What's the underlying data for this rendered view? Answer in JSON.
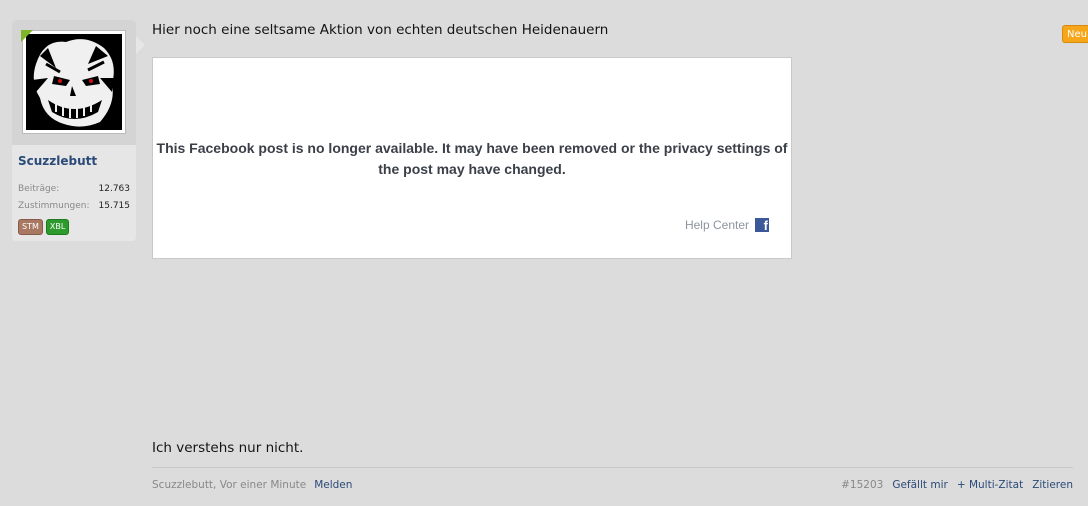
{
  "user": {
    "name": "Scuzzlebutt",
    "stats": [
      {
        "label": "Beiträge:",
        "value": "12.763"
      },
      {
        "label": "Zustimmungen:",
        "value": "15.715"
      }
    ],
    "badges": [
      "STM",
      "XBL"
    ]
  },
  "post": {
    "text": "Hier noch eine seltsame Aktion von echten deutschen Heidenauern",
    "embed": {
      "message": "This Facebook post is no longer available. It may have been removed or the privacy settings of the post may have changed.",
      "help_label": "Help Center",
      "icon": "facebook-icon"
    },
    "second_text": "Ich verstehs nur nicht.",
    "new_tag": "Neu",
    "footer": {
      "author_time": "Scuzzlebutt, Vor einer Minute",
      "report": "Melden",
      "post_number": "#15203",
      "like": "Gefällt mir",
      "multi_quote": "+ Multi-Zitat",
      "quote": "Zitieren"
    }
  },
  "colors": {
    "background": "#dcdcdc",
    "link": "#2b4a78",
    "new_tag": "#f6a61b",
    "facebook": "#3b5998"
  }
}
